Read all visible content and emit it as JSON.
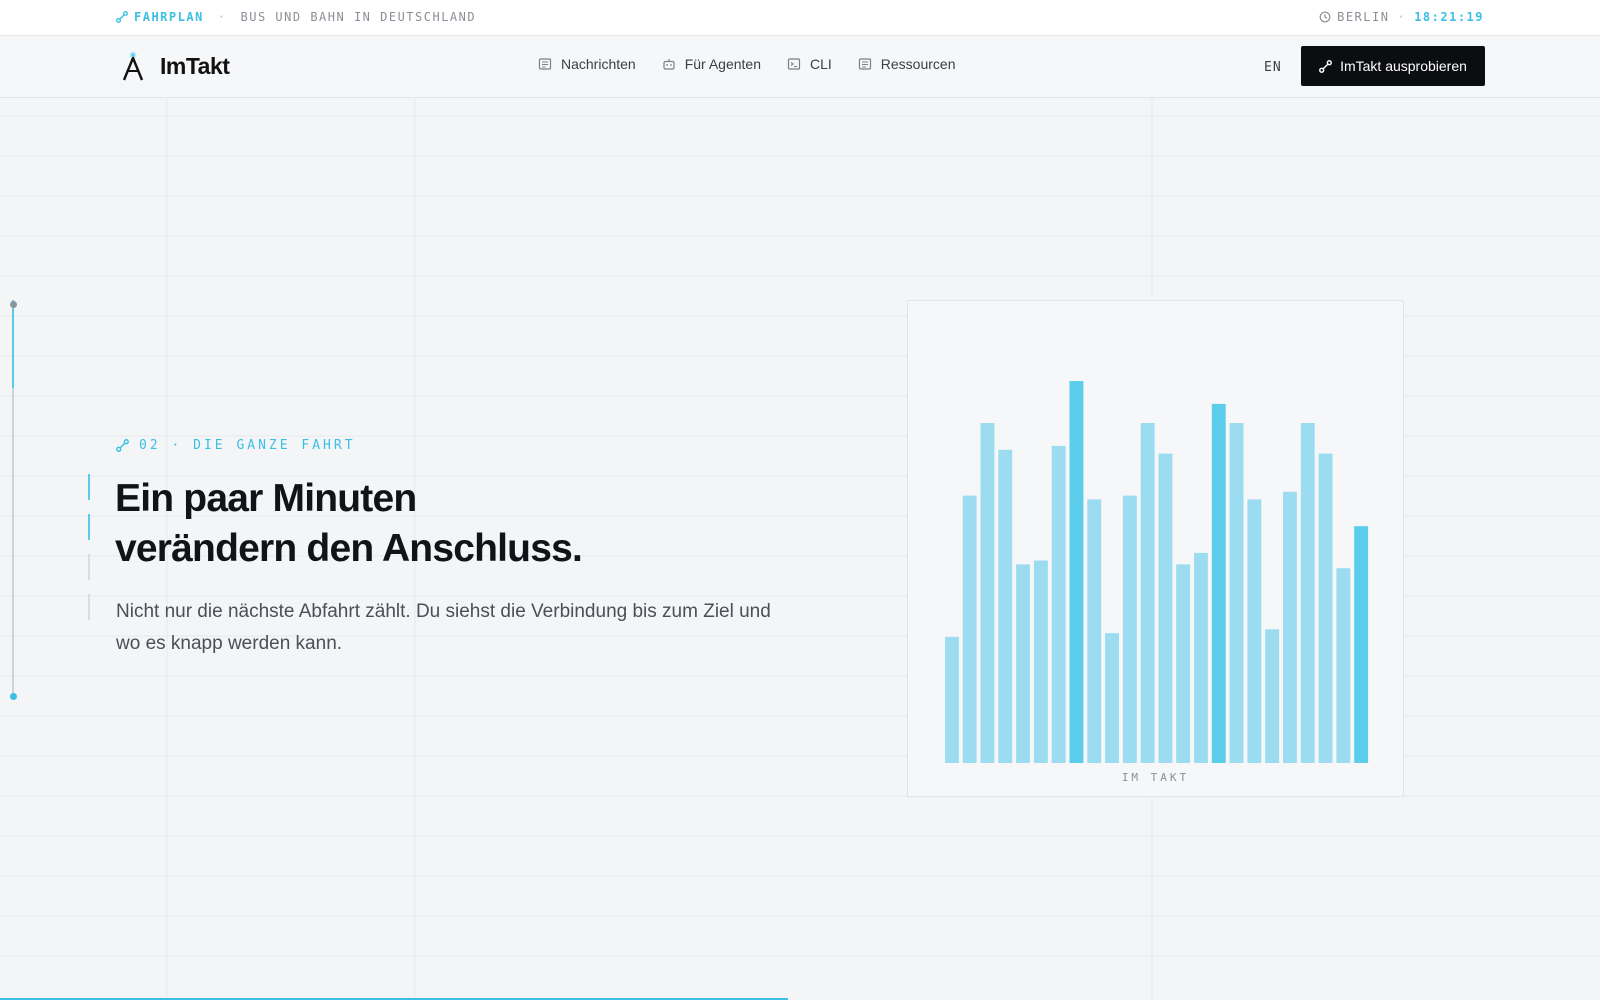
{
  "topbar": {
    "left_accent": "FAHRPLAN",
    "left_sep": "·",
    "left_text": "BUS UND BAHN IN DEUTSCHLAND",
    "city": "BERLIN",
    "time_sep": "·",
    "time": "18:21:19"
  },
  "nav": {
    "brand": "ImTakt",
    "links": [
      {
        "label": "Nachrichten",
        "icon": "newspaper-icon"
      },
      {
        "label": "Für Agenten",
        "icon": "robot-icon"
      },
      {
        "label": "CLI",
        "icon": "terminal-icon"
      },
      {
        "label": "Ressourcen",
        "icon": "document-icon"
      }
    ],
    "lang": "EN",
    "cta": "ImTakt ausprobieren"
  },
  "hero": {
    "eyebrow": "02 · DIE GANZE FAHRT",
    "headline_line1": "Ein paar Minuten",
    "headline_line2": "verändern den Anschluss.",
    "lead": "Nicht nur die nächste Abfahrt zählt. Du siehst die Verbindung bis zum Ziel und wo es knapp werden kann."
  },
  "chart_data": {
    "type": "bar",
    "title": "",
    "caption": "IM TAKT",
    "xlabel": "",
    "ylabel": "",
    "values": [
      33,
      70,
      89,
      82,
      52,
      53,
      83,
      100,
      69,
      34,
      70,
      89,
      81,
      52,
      55,
      94,
      89,
      69,
      35,
      71,
      89,
      81,
      51,
      62
    ],
    "highlight": [
      false,
      false,
      false,
      false,
      false,
      false,
      false,
      true,
      false,
      false,
      false,
      false,
      false,
      false,
      false,
      true,
      false,
      false,
      false,
      false,
      false,
      false,
      false,
      true
    ],
    "ylim": [
      0,
      100
    ],
    "grid": false
  },
  "colors": {
    "accent": "#3bbfe3",
    "bar": "#9bdcf1",
    "bar_highlight": "#5ccdea",
    "cta_bg": "#0b0d10"
  }
}
